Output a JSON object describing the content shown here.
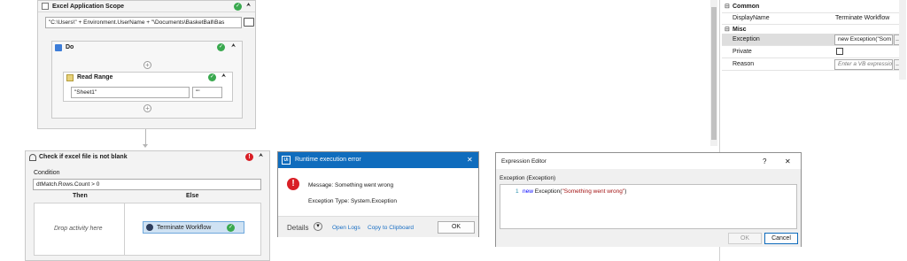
{
  "excel_scope": {
    "title": "Excel Application Scope",
    "path_value": "\"C:\\Users\\\" + Environment.UserName + \"\\Documents\\BasketBall\\Bas",
    "do_title": "Do",
    "read_range": {
      "title": "Read Range",
      "sheet_value": "\"Sheet1\"",
      "range_value": "\"\""
    }
  },
  "if_activity": {
    "title": "Check if excel file is not blank",
    "condition_label": "Condition",
    "condition_value": "dtMatch.Rows.Count > 0",
    "then_label": "Then",
    "else_label": "Else",
    "drop_hint": "Drop activity here",
    "terminate_label": "Terminate Workflow"
  },
  "properties": {
    "common_header": "Common",
    "display_name_label": "DisplayName",
    "display_name_value": "Terminate Workflow",
    "misc_header": "Misc",
    "exception_label": "Exception",
    "exception_value": "new Exception(\"Som",
    "private_label": "Private",
    "reason_label": "Reason",
    "reason_placeholder": "Enter a VB expressio",
    "ellipsis": "..."
  },
  "runtime_dialog": {
    "title": "Runtime execution error",
    "message": "Message: Something went wrong",
    "exception_type": "Exception Type: System.Exception",
    "details_label": "Details",
    "open_logs": "Open Logs",
    "copy_clipboard": "Copy to Clipboard",
    "ok_label": "OK",
    "close_glyph": "✕",
    "app_badge": "Ui"
  },
  "expression_editor": {
    "title": "Expression Editor",
    "help_glyph": "?",
    "close_glyph": "✕",
    "section_label": "Exception (Exception)",
    "line_number": "1",
    "code_keyword": "new",
    "code_class": " Exception(",
    "code_string": "\"Something went wrong\"",
    "code_tail": ")",
    "ok_label": "OK",
    "cancel_label": "Cancel"
  },
  "icons": {
    "check": "✓",
    "chevron_up": "⮝",
    "plus": "+",
    "minus": "⊟",
    "folder": "folder-icon",
    "dropdown": "▾"
  }
}
